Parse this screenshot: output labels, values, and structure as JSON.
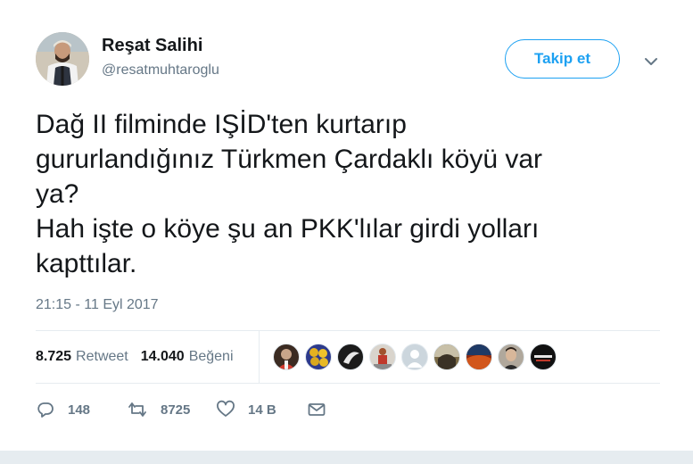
{
  "user": {
    "name": "Reşat Salihi",
    "handle": "@resatmuhtaroglu",
    "avatar_icon": "profile-photo"
  },
  "follow_button": {
    "label": "Takip et"
  },
  "tweet": {
    "lines": [
      "Dağ II filminde IŞİD'ten kurtarıp",
      "gururlandığınız Türkmen Çardaklı köyü var",
      "ya?",
      "Hah işte o köye şu an PKK'lılar girdi yolları",
      "kapttılar."
    ],
    "timestamp": "21:15 - 11 Eyl 2017"
  },
  "stats": {
    "retweets": {
      "count": "8.725",
      "label": "Retweet"
    },
    "likes": {
      "count": "14.040",
      "label": "Beğeni"
    }
  },
  "likers": [
    {
      "icon": "liker-avatar-1",
      "color": "#3b2b22"
    },
    {
      "icon": "liker-avatar-2",
      "color": "#d9a81f"
    },
    {
      "icon": "liker-avatar-3",
      "color": "#1b1b1b"
    },
    {
      "icon": "liker-avatar-4",
      "color": "#c9c4bb"
    },
    {
      "icon": "liker-avatar-default",
      "color": "#ccd6dd"
    },
    {
      "icon": "liker-avatar-6",
      "color": "#6a5a3a"
    },
    {
      "icon": "liker-avatar-7",
      "color": "#8a2a12"
    },
    {
      "icon": "liker-avatar-8",
      "color": "#9a9086"
    },
    {
      "icon": "liker-avatar-9",
      "color": "#111111"
    }
  ],
  "actions": {
    "reply": {
      "icon": "reply-icon",
      "count": "148"
    },
    "retweet": {
      "icon": "retweet-icon",
      "count": "8725"
    },
    "like": {
      "icon": "heart-icon",
      "count": "14 B"
    },
    "message": {
      "icon": "envelope-icon"
    }
  },
  "colors": {
    "accent": "#1da1f2",
    "text": "#14171a",
    "secondary": "#657786",
    "divider": "#e6ecf0"
  }
}
